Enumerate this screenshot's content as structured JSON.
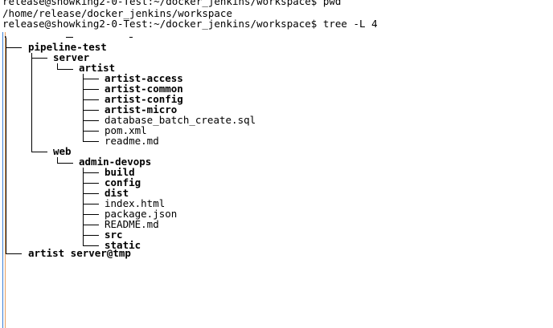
{
  "terminal": {
    "prompt_line_1": "release@showking2-0-Test:~/docker_jenkins/workspace$ pwd",
    "output_line_1": "/home/release/docker_jenkins/workspace",
    "prompt_line_2": "release@showking2-0-Test:~/docker_jenkins/workspace$ tree -L 4",
    "root": ".",
    "tree": {
      "pipeline_test": "pipeline-test",
      "server": "server",
      "artist": "artist",
      "artist_items": [
        "artist-access",
        "artist-common",
        "artist-config",
        "artist-micro",
        "database_batch_create.sql",
        "pom.xml",
        "readme.md"
      ],
      "web": "web",
      "admin_devops": "admin-devops",
      "admin_items": [
        "build",
        "config",
        "dist",
        "index.html",
        "package.json",
        "README.md",
        "src",
        "static"
      ],
      "artist_server_tmp": "artist server@tmp"
    }
  }
}
